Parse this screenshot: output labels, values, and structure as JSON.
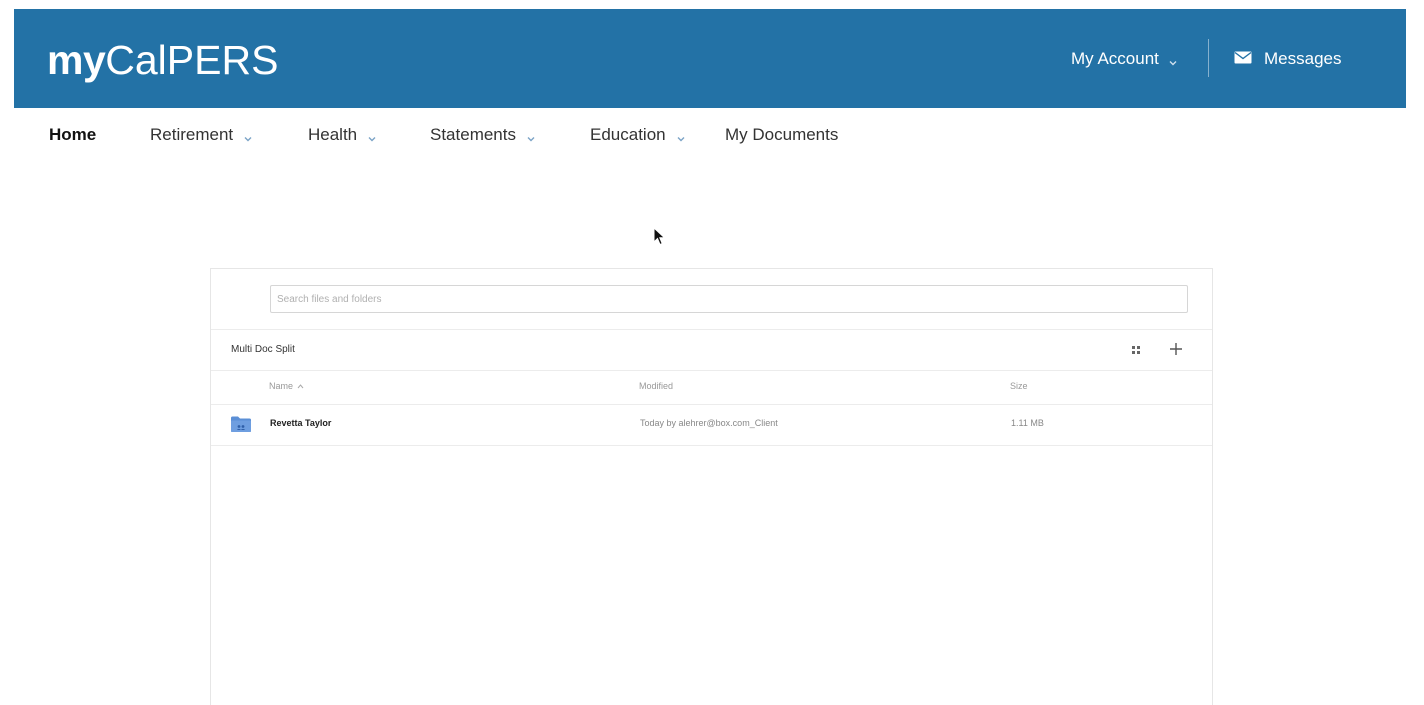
{
  "header": {
    "brand_bold": "my",
    "brand_light": "CalPERS",
    "account_label": "My Account",
    "messages_label": "Messages"
  },
  "nav": {
    "items": [
      {
        "label": "Home",
        "active": true,
        "has_dropdown": false
      },
      {
        "label": "Retirement",
        "has_dropdown": true
      },
      {
        "label": "Health",
        "has_dropdown": true
      },
      {
        "label": "Statements",
        "has_dropdown": true
      },
      {
        "label": "Education",
        "has_dropdown": true
      },
      {
        "label": "My Documents",
        "has_dropdown": false
      }
    ]
  },
  "file_browser": {
    "search_placeholder": "Search files and folders",
    "current_folder": "Multi Doc Split",
    "columns": {
      "name": "Name",
      "modified": "Modified",
      "size": "Size"
    },
    "rows": [
      {
        "name": "Revetta Taylor",
        "modified": "Today by alehrer@box.com_Client",
        "size": "1.11 MB",
        "icon": "folder-icon"
      }
    ]
  },
  "colors": {
    "header_bg": "#2372a6",
    "folder_blue": "#5b8fd6"
  }
}
